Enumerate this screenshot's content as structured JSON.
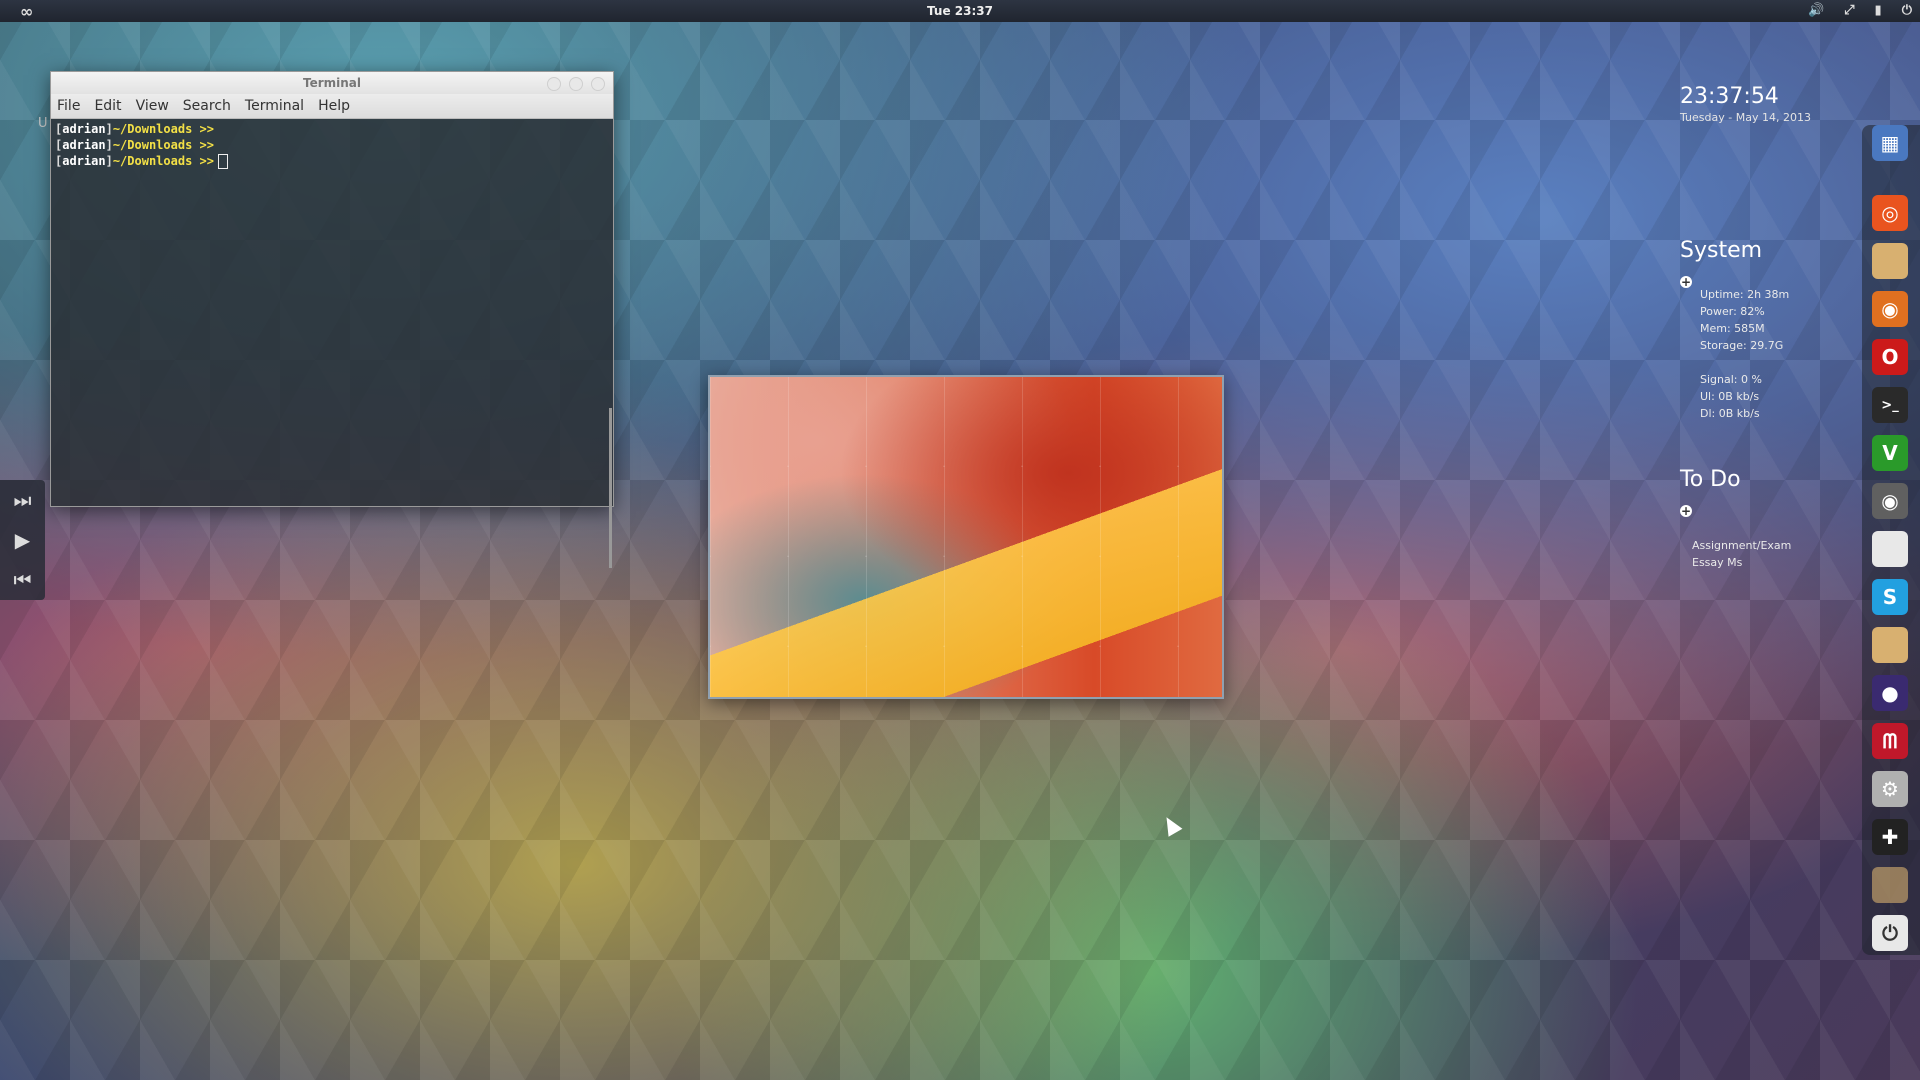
{
  "topbar": {
    "clock": "Tue 23:37",
    "logo_icon": "infinity-icon",
    "tray_icons": [
      "volume-icon",
      "network-icon",
      "battery-icon",
      "power-icon"
    ]
  },
  "terminal": {
    "title": "Terminal",
    "menu": [
      "File",
      "Edit",
      "View",
      "Search",
      "Terminal",
      "Help"
    ],
    "lines": [
      {
        "user": "adrian",
        "path": "~/Downloads >>"
      },
      {
        "user": "adrian",
        "path": "~/Downloads >>"
      },
      {
        "user": "adrian",
        "path": "~/Downloads >>"
      }
    ]
  },
  "left_ghost_text": "U",
  "media_controls": [
    "next-track-icon",
    "play-icon",
    "previous-track-icon"
  ],
  "conky_time": {
    "time": "23:37:54",
    "date": "Tuesday - May 14, 2013"
  },
  "conky_system": {
    "heading": "System",
    "items": [
      "Uptime: 2h 38m",
      "Power: 82%",
      "Mem: 585M",
      "Storage: 29.7G"
    ],
    "net_items": [
      "Signal: 0   %",
      "Ul: 0B    kb/s",
      "Dl: 0B    kb/s"
    ]
  },
  "conky_todo": {
    "heading": "To Do",
    "items": [
      "Assignment/Exam",
      "Essay Ms"
    ]
  },
  "dock": {
    "items": [
      {
        "name": "workspace-switcher-icon",
        "color": "#4a78c0"
      },
      {
        "name": "ubuntu-icon",
        "color": "#e9541f"
      },
      {
        "name": "files-icon",
        "color": "#d8b070"
      },
      {
        "name": "firefox-icon",
        "color": "#e07020"
      },
      {
        "name": "opera-icon",
        "color": "#cc1a1a"
      },
      {
        "name": "terminal-icon",
        "color": "#2a2a2a"
      },
      {
        "name": "vim-icon",
        "color": "#2a9a2a"
      },
      {
        "name": "speaker-icon",
        "color": "#606060"
      },
      {
        "name": "text-document-icon",
        "color": "#e8e8e8"
      },
      {
        "name": "skype-icon",
        "color": "#22a0e0"
      },
      {
        "name": "folder-icon",
        "color": "#d8b070"
      },
      {
        "name": "eclipse-icon",
        "color": "#3a2a70"
      },
      {
        "name": "mendeley-icon",
        "color": "#c0182a"
      },
      {
        "name": "settings-icon",
        "color": "#b0b0b0"
      },
      {
        "name": "add-icon",
        "color": "#222222"
      },
      {
        "name": "folder-icon",
        "color": "#d8b070"
      },
      {
        "name": "shutdown-icon",
        "color": "#e8e8e8"
      }
    ]
  }
}
